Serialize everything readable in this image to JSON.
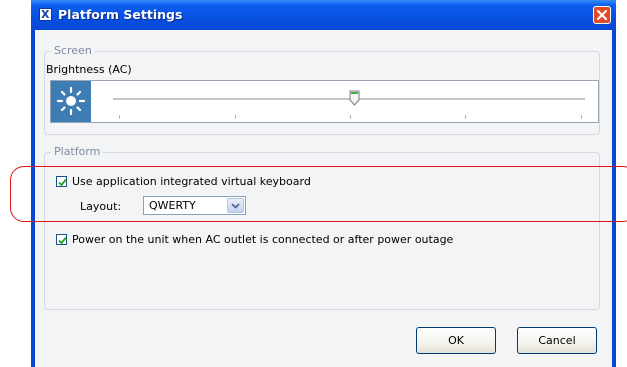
{
  "window": {
    "title": "Platform Settings",
    "app_icon_letter": "X"
  },
  "screen_group": {
    "label": "Screen",
    "brightness_label": "Brightness (AC)",
    "brightness_level": 0.5
  },
  "platform_group": {
    "label": "Platform",
    "virtual_keyboard": {
      "label": "Use application integrated virtual keyboard",
      "checked": true
    },
    "layout": {
      "label": "Layout:",
      "value": "QWERTY"
    },
    "power_on": {
      "label": "Power on the unit when AC outlet is connected or after power outage",
      "checked": true
    }
  },
  "buttons": {
    "ok": "OK",
    "cancel": "Cancel"
  },
  "colors": {
    "titlebar": "#0a46d6",
    "highlight": "#e01414",
    "accent_tile": "#3e7db4"
  }
}
